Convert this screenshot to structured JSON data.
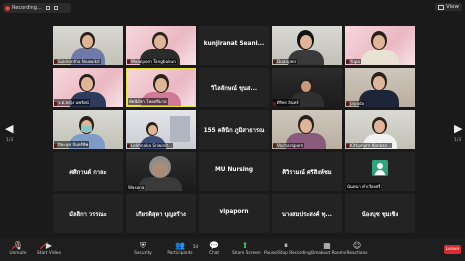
{
  "topbar": {
    "recording_label": "Recording...",
    "view_label": "View"
  },
  "pager": {
    "left": "1/3",
    "right": "1/3"
  },
  "tiles": [
    {
      "label": "Sukhontha Noawikit",
      "type": "video"
    },
    {
      "label": "Walaiporn Tangbukun",
      "type": "video"
    },
    {
      "name": "kunjiranat Seani...",
      "type": "name"
    },
    {
      "label": "Duanpen",
      "type": "video"
    },
    {
      "label": "Yupa",
      "type": "video"
    },
    {
      "label": "ร.ต.หญิง นพรัตน์",
      "type": "video"
    },
    {
      "label": "ทัศนีย์ชา โหดศรีมาส",
      "type": "video"
    },
    {
      "name": "วิไลลักษณ์ ขุนส...",
      "type": "name"
    },
    {
      "label": "ศิริพร อินทร์",
      "type": "video"
    },
    {
      "label": "Jayada",
      "type": "video"
    },
    {
      "label": "ปิยะนุช จันทร์ทิพ",
      "type": "video"
    },
    {
      "label": "Lekhnaka Sriwinit...",
      "type": "video"
    },
    {
      "name": "155 คลินิก ภูมิสาธารณ",
      "type": "name"
    },
    {
      "label": "Vacharaporn",
      "type": "video"
    },
    {
      "label": "Kittiphorn Konkan...",
      "type": "video"
    },
    {
      "name": "ศศิกานต์ กาละ",
      "type": "name"
    },
    {
      "label": "Wasana",
      "type": "video"
    },
    {
      "name": "MU Nursing",
      "type": "name"
    },
    {
      "name": "ศิวิรามณ์ ศรีสิงห์ชม",
      "type": "name"
    },
    {
      "label": "นันทนา คำเวียงศรี",
      "type": "avatar"
    },
    {
      "name": "มัลลิกา วรรณะ",
      "type": "name"
    },
    {
      "name": "เกียรติสุดา บุญสร้าง",
      "type": "name"
    },
    {
      "name": "vipaporn",
      "type": "name"
    },
    {
      "name": "นางสมประสงค์ ทุ...",
      "type": "name"
    },
    {
      "name": "น้องบุช ชุมเชิง",
      "type": "name"
    }
  ],
  "toolbar": {
    "unmute": "Unmute",
    "start_video": "Start Video",
    "security": "Security",
    "participants": "Participants",
    "participants_count": "54",
    "chat": "Chat",
    "share_screen": "Share Screen",
    "pause_recording": "Pause/Stop Recording",
    "breakout_rooms": "Breakout Rooms",
    "reactions": "Reactions",
    "leave": "Leave"
  }
}
